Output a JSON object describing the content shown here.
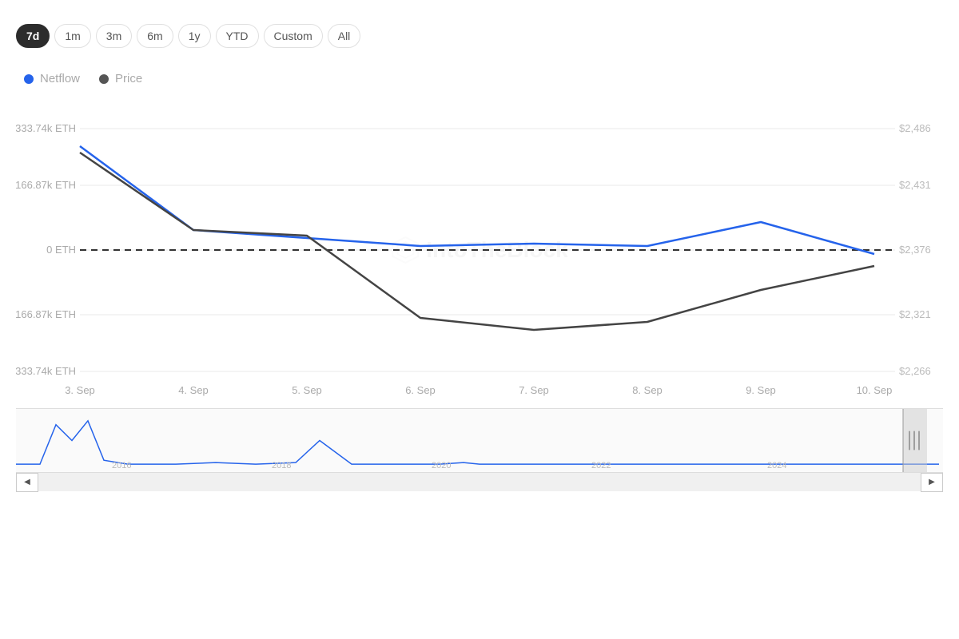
{
  "timeRange": {
    "buttons": [
      {
        "label": "7d",
        "active": true
      },
      {
        "label": "1m",
        "active": false
      },
      {
        "label": "3m",
        "active": false
      },
      {
        "label": "6m",
        "active": false
      },
      {
        "label": "1y",
        "active": false
      },
      {
        "label": "YTD",
        "active": false
      },
      {
        "label": "Custom",
        "active": false
      },
      {
        "label": "All",
        "active": false
      }
    ]
  },
  "legend": {
    "netflow": {
      "label": "Netflow"
    },
    "price": {
      "label": "Price"
    }
  },
  "yAxisLeft": {
    "labels": [
      "333.74k ETH",
      "166.87k ETH",
      "0 ETH",
      "-166.87k ETH",
      "-333.74k ETH"
    ]
  },
  "yAxisRight": {
    "labels": [
      "$2,486",
      "$2,431",
      "$2,376",
      "$2,321",
      "$2,266"
    ]
  },
  "xAxis": {
    "labels": [
      "3. Sep",
      "4. Sep",
      "5. Sep",
      "6. Sep",
      "7. Sep",
      "8. Sep",
      "9. Sep",
      "10. Sep"
    ]
  },
  "miniChart": {
    "yearLabels": [
      "2016",
      "2018",
      "2020",
      "2022",
      "2024"
    ]
  },
  "watermark": "IntoTheBlock"
}
